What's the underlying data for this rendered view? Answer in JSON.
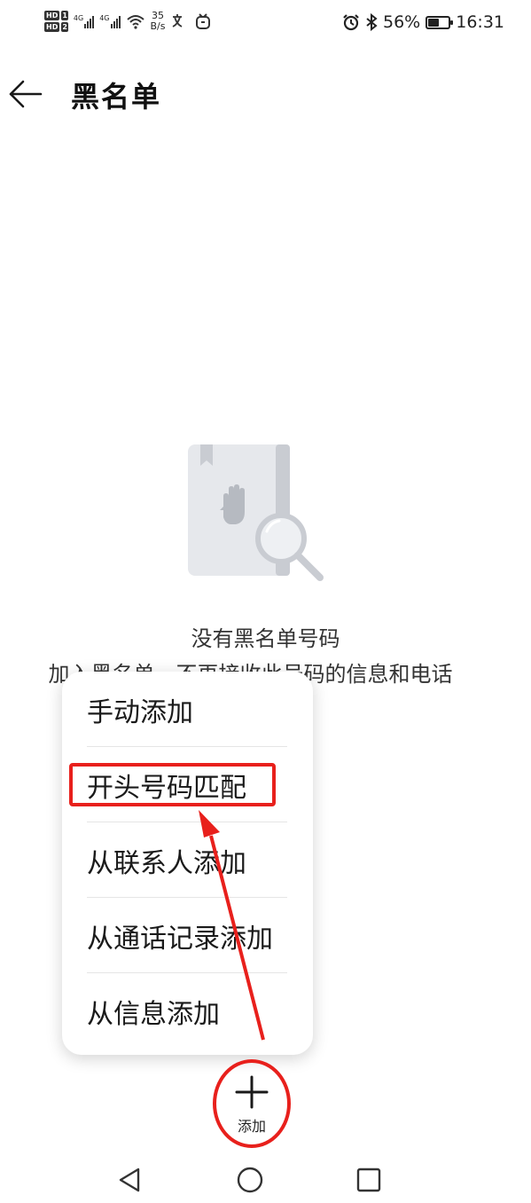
{
  "status_bar": {
    "hd1": "HD",
    "sim1": "1",
    "hd2": "HD",
    "sim2": "2",
    "net1": "4G",
    "net2": "4G",
    "speed_value": "35",
    "speed_unit": "B/s",
    "battery_percent": "56%",
    "battery_level": 0.56,
    "time": "16:31"
  },
  "header": {
    "back_icon": "arrow-left-icon",
    "title": "黑名单"
  },
  "empty_state": {
    "icon": "blocklist-book-search-icon",
    "title": "没有黑名单号码",
    "description": "加入黑名单，不再接收此号码的信息和电话"
  },
  "popup_menu": {
    "items": [
      {
        "label": "手动添加"
      },
      {
        "label": "开头号码匹配"
      },
      {
        "label": "从联系人添加"
      },
      {
        "label": "从通话记录添加"
      },
      {
        "label": "从信息添加"
      }
    ]
  },
  "fab": {
    "icon": "plus-icon",
    "label": "添加"
  },
  "nav_bar": {
    "back": "triangle-back-icon",
    "home": "circle-home-icon",
    "recents": "square-recents-icon"
  },
  "colors": {
    "annotation_red": "#e8201c",
    "text": "#1a1a1a"
  }
}
